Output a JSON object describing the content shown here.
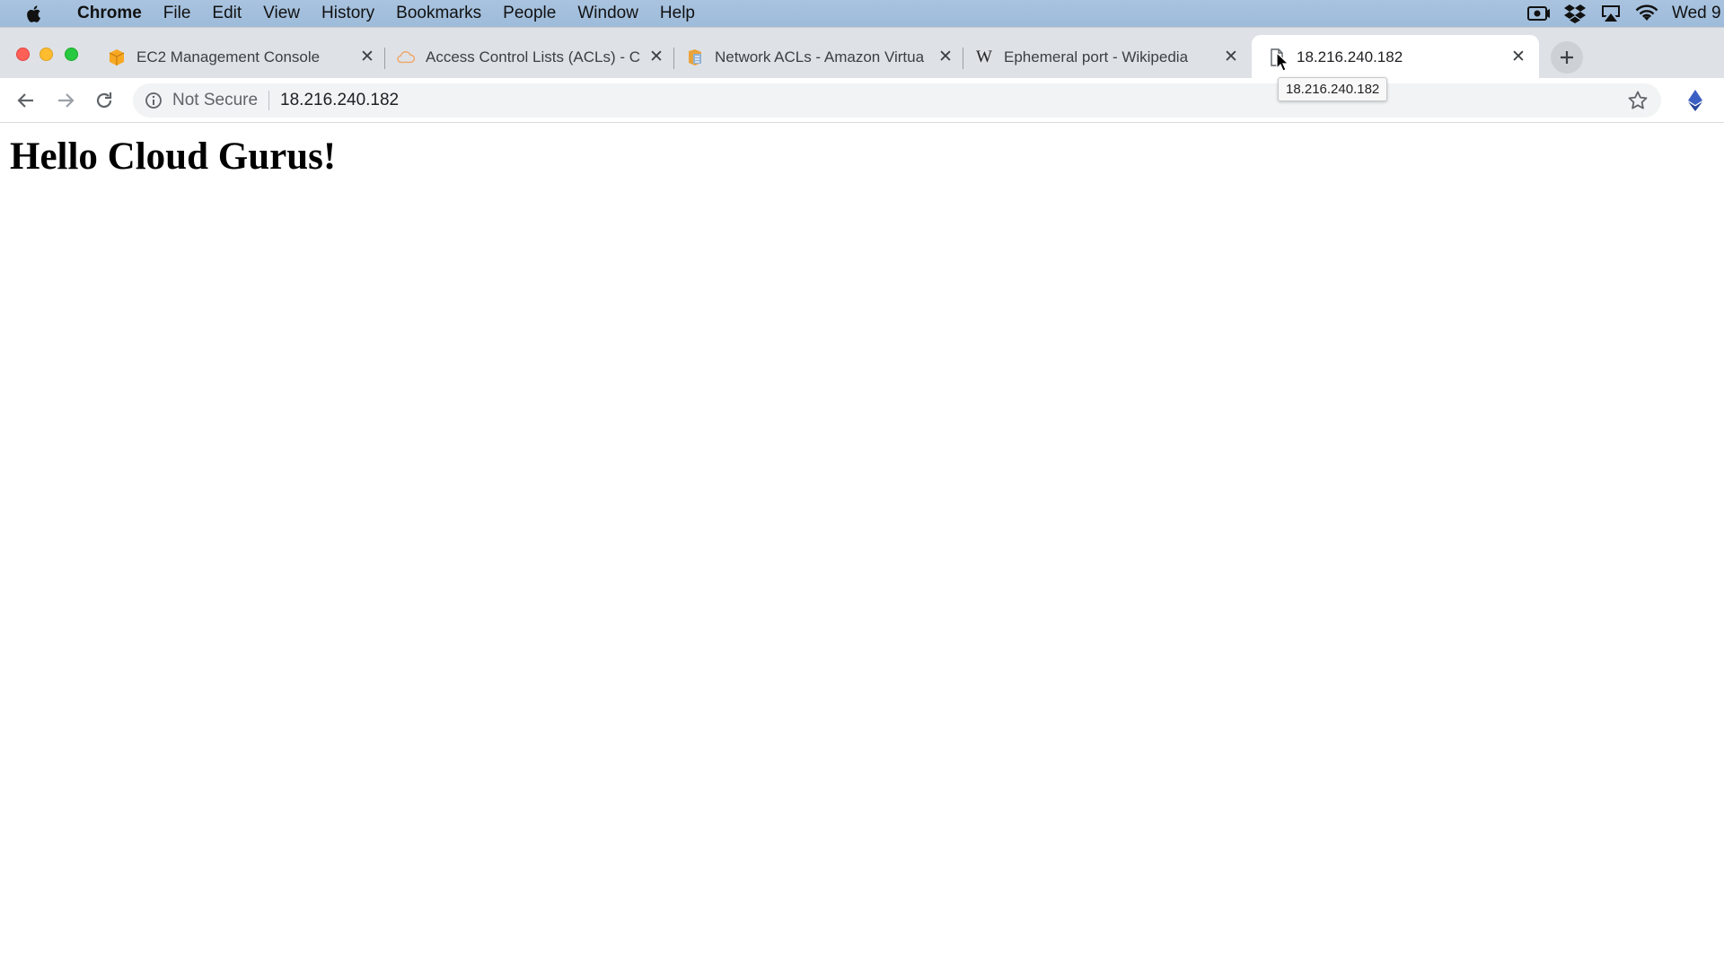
{
  "menubar": {
    "items": [
      "Chrome",
      "File",
      "Edit",
      "View",
      "History",
      "Bookmarks",
      "People",
      "Window",
      "Help"
    ],
    "clock": "Wed 9"
  },
  "tabs": [
    {
      "title": "EC2 Management Console",
      "favicon": "aws-cube-icon"
    },
    {
      "title": "Access Control Lists (ACLs) - C",
      "favicon": "cloud-icon"
    },
    {
      "title": "Network ACLs - Amazon Virtua",
      "favicon": "aws-doc-icon"
    },
    {
      "title": "Ephemeral port - Wikipedia",
      "favicon": "wikipedia-icon"
    },
    {
      "title": "18.216.240.182",
      "favicon": "page-icon"
    }
  ],
  "tooltip": "18.216.240.182",
  "omnibox": {
    "security": "Not Secure",
    "url": "18.216.240.182"
  },
  "page": {
    "heading": "Hello Cloud Gurus!"
  },
  "colors": {
    "menubar_bg": "#a9c3df",
    "tabstrip_bg": "#dee1e6",
    "omnibox_bg": "#f1f3f4"
  }
}
